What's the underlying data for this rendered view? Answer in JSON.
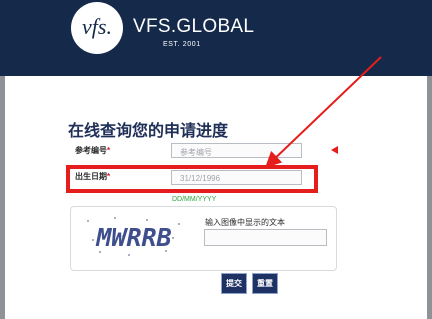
{
  "header": {
    "logo_mark": "vfs.",
    "brand": "VFS.GLOBAL",
    "est": "EST. 2001"
  },
  "form": {
    "title": "在线查询您的申请进度",
    "reference": {
      "label": "参考编号",
      "required_mark": "*",
      "placeholder": "参考编号"
    },
    "dob": {
      "label": "出生日期",
      "required_mark": "*",
      "value": "31/12/1996",
      "format_hint": "DD/MM/YYYY"
    },
    "captcha": {
      "image_text": "MWRRB",
      "label": "输入图像中显示的文本",
      "value": ""
    },
    "buttons": {
      "submit": "提交",
      "reset": "重置"
    }
  },
  "annotation": {
    "color": "#e51d1d"
  }
}
